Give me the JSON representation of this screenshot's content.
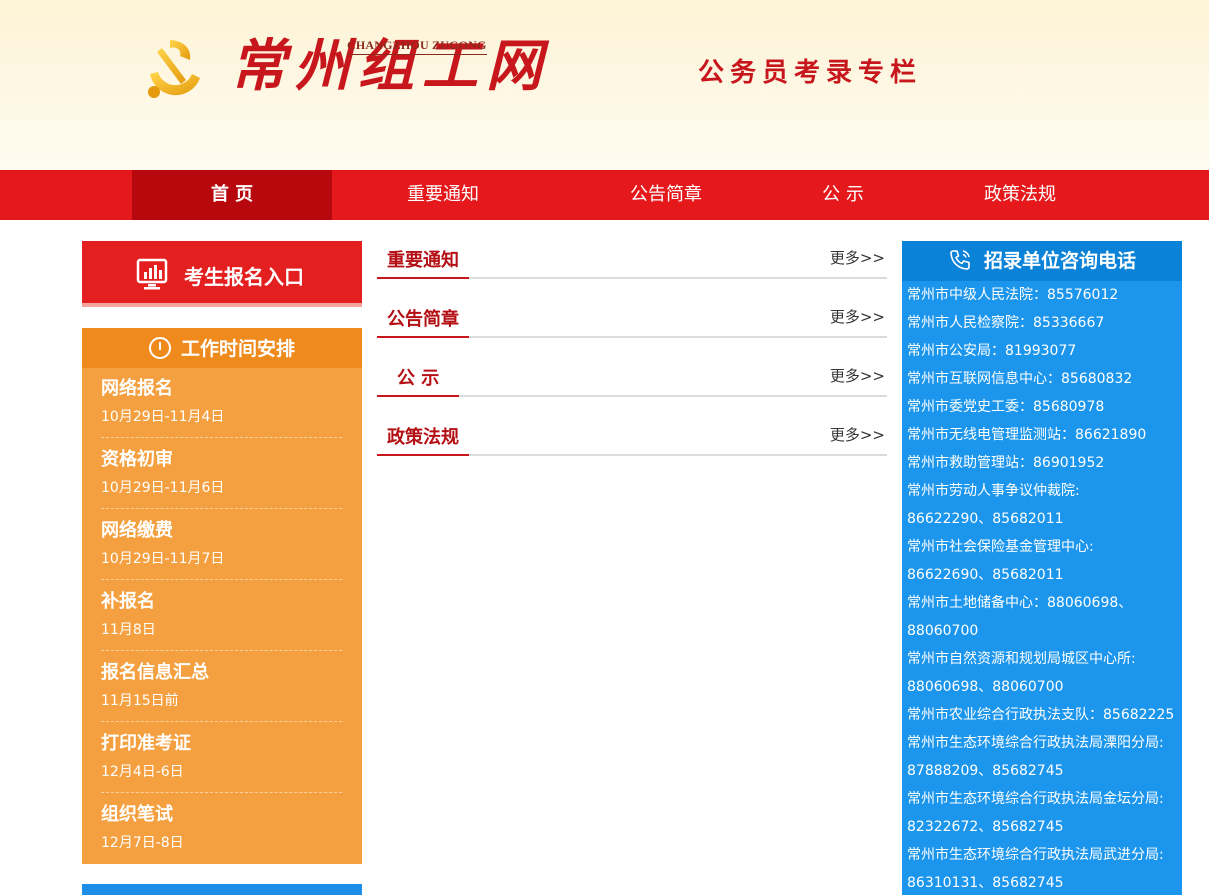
{
  "header": {
    "logo_text": "常州组工网",
    "logo_pinyin": "CHANGZHOU ZUGONG",
    "column_title": "公务员考录专栏"
  },
  "nav": {
    "items": [
      {
        "label": "首 页"
      },
      {
        "label": "重要通知"
      },
      {
        "label": "公告简章"
      },
      {
        "label": "公 示"
      },
      {
        "label": "政策法规"
      }
    ]
  },
  "sidebar": {
    "signup_label": "考生报名入口",
    "schedule_title": "工作时间安排",
    "schedule": [
      {
        "title": "网络报名",
        "date": "10月29日-11月4日"
      },
      {
        "title": "资格初审",
        "date": "10月29日-11月6日"
      },
      {
        "title": "网络缴费",
        "date": "10月29日-11月7日"
      },
      {
        "title": "补报名",
        "date": "11月8日"
      },
      {
        "title": "报名信息汇总",
        "date": "11月15日前"
      },
      {
        "title": "打印准考证",
        "date": "12月4日-6日"
      },
      {
        "title": "组织笔试",
        "date": "12月7日-8日"
      }
    ]
  },
  "main": {
    "more_label": "更多>>",
    "sections": [
      {
        "title": "重要通知"
      },
      {
        "title": "公告简章"
      },
      {
        "title": "公 示"
      },
      {
        "title": "政策法规"
      }
    ]
  },
  "contact": {
    "title": "招录单位咨询电话",
    "lines": [
      "常州市中级人民法院：85576012",
      "常州市人民检察院：85336667",
      "常州市公安局：81993077",
      "常州市互联网信息中心：85680832",
      "常州市委党史工委：85680978",
      "常州市无线电管理监测站：86621890",
      "常州市救助管理站：86901952",
      "常州市劳动人事争议仲裁院:",
      "86622290、85682011",
      "常州市社会保险基金管理中心:",
      "86622690、85682011",
      "常州市土地储备中心：88060698、",
      "88060700",
      "常州市自然资源和规划局城区中心所:",
      "88060698、88060700",
      "常州市农业综合行政执法支队：85682225",
      "常州市生态环境综合行政执法局溧阳分局:",
      "87888209、85682745",
      "常州市生态环境综合行政执法局金坛分局:",
      "82322672、85682745",
      "常州市生态环境综合行政执法局武进分局:",
      "86310131、85682745"
    ]
  },
  "colors": {
    "brand_red": "#e5191c",
    "nav_active": "#b7090d",
    "schedule_orange": "#f5a040",
    "contact_blue": "#1c96ec"
  }
}
